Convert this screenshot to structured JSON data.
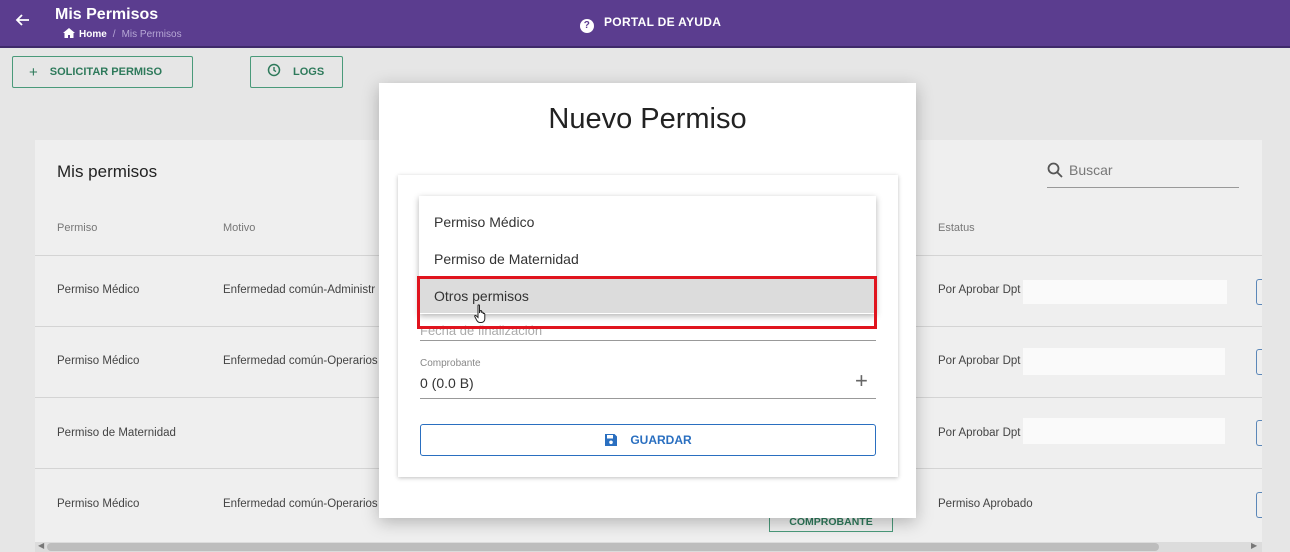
{
  "header": {
    "title": "Mis Permisos",
    "breadcrumb_home": "Home",
    "breadcrumb_sep": "/",
    "breadcrumb_current": "Mis Permisos",
    "help_label": "PORTAL DE AYUDA",
    "accent_color": "#5b3d8f"
  },
  "toolbar": {
    "request_label": "SOLICITAR PERMISO",
    "logs_label": "LOGS"
  },
  "list": {
    "title": "Mis permisos",
    "search_placeholder": "Buscar",
    "columns": {
      "permiso": "Permiso",
      "motivo": "Motivo",
      "estatus": "Estatus"
    },
    "rows": [
      {
        "permiso": "Permiso Médico",
        "motivo": "Enfermedad común-Administr",
        "estatus": "Por Aprobar Dpt"
      },
      {
        "permiso": "Permiso Médico",
        "motivo": "Enfermedad común-Operarios",
        "estatus": "Por Aprobar Dpt"
      },
      {
        "permiso": "Permiso de Maternidad",
        "motivo": "",
        "estatus": "Por Aprobar Dpt"
      },
      {
        "permiso": "Permiso Médico",
        "motivo": "Enfermedad común-Operarios",
        "estatus": "Permiso Aprobado"
      }
    ],
    "comprobante_button": "COMPROBANTE"
  },
  "modal": {
    "title": "Nuevo Permiso",
    "fecha_placeholder": "Fecha de finalización",
    "comprobante_label": "Comprobante",
    "comprobante_value": "0 (0.0 B)",
    "save_label": "GUARDAR",
    "dropdown_options": [
      "Permiso Médico",
      "Permiso de Maternidad",
      "Otros permisos"
    ],
    "hovered_option": "Otros permisos"
  }
}
